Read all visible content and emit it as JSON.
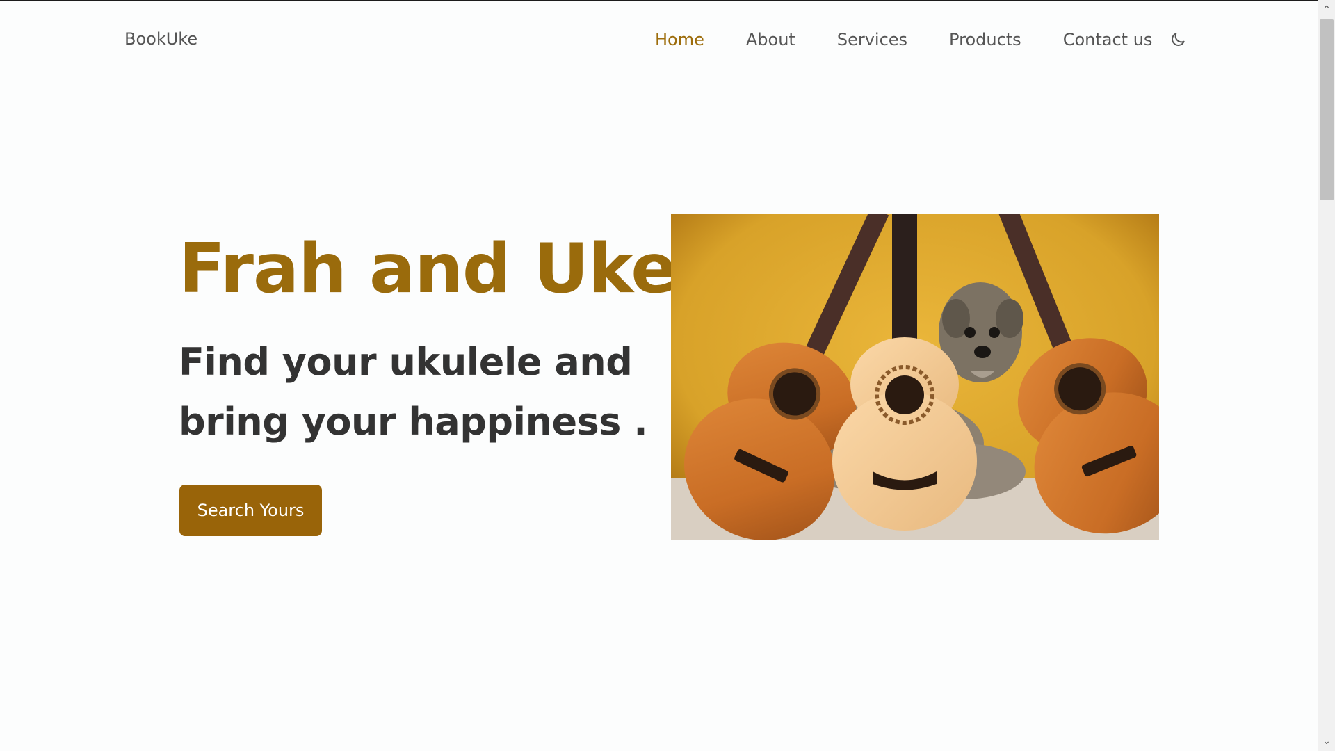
{
  "brand": "BookUke",
  "nav": [
    {
      "label": "Home",
      "active": true
    },
    {
      "label": "About",
      "active": false
    },
    {
      "label": "Services",
      "active": false
    },
    {
      "label": "Products",
      "active": false
    },
    {
      "label": "Contact us",
      "active": false
    }
  ],
  "theme_toggle_icon": "moon-icon",
  "hero": {
    "title": "Frah and Uke",
    "subtitle": "Find your ukulele and bring your happiness .",
    "cta_label": "Search Yours",
    "image_subject": "three ukuleles with a small dog on a mustard background"
  },
  "colors": {
    "accent": "#9a6b0c",
    "button": "#996409",
    "text_dark": "#333333",
    "text_nav": "#555555",
    "background": "#fcfdfd"
  },
  "scrollbar": {
    "up_glyph": "⌃",
    "down_glyph": "⌄"
  }
}
